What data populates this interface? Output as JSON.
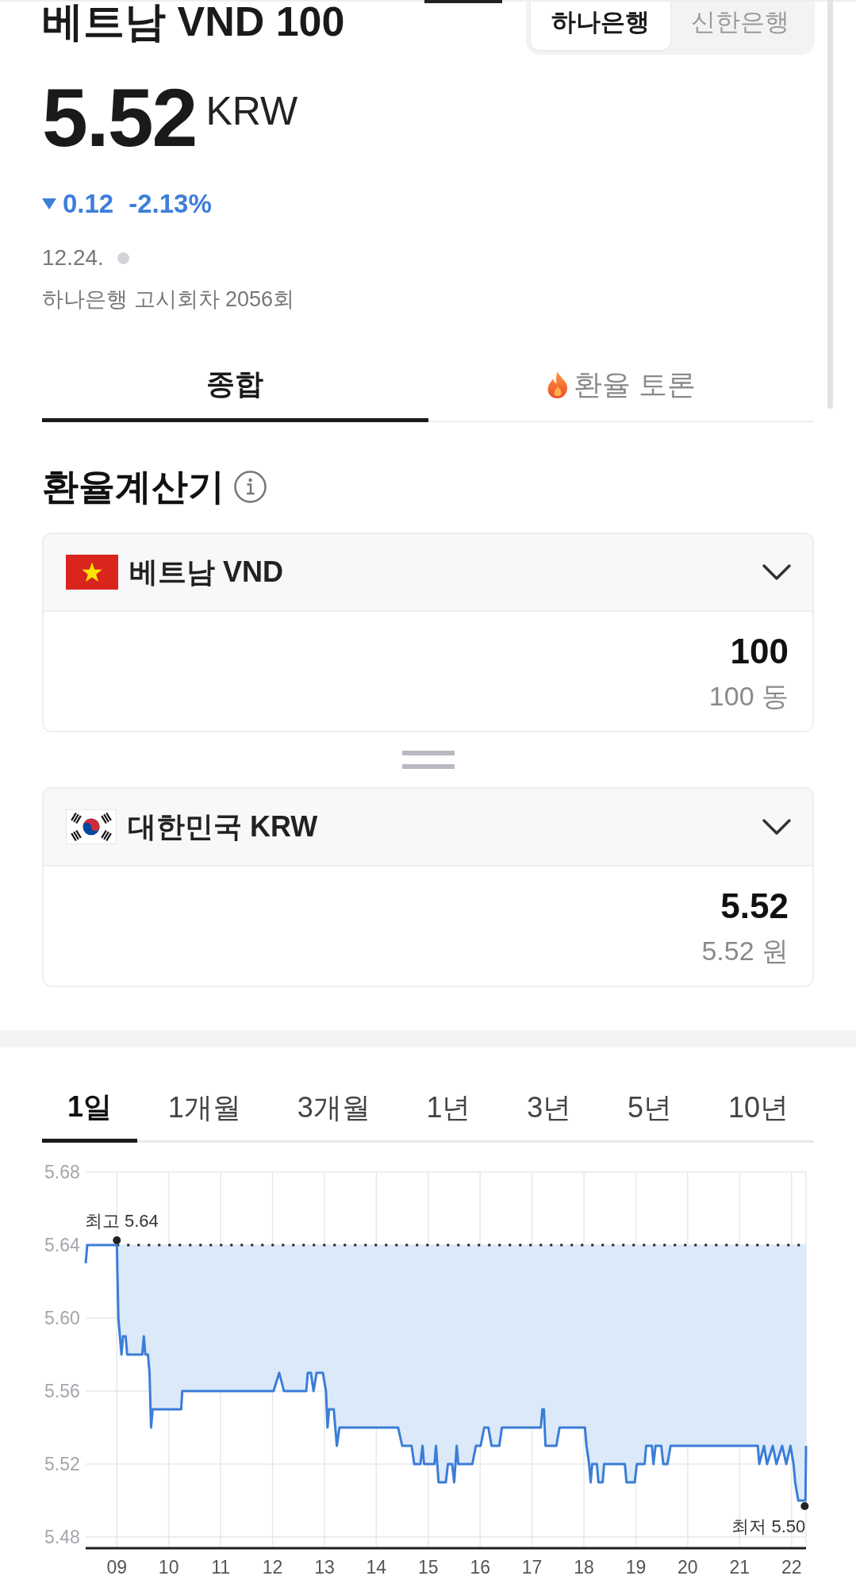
{
  "header": {
    "title": "베트남 VND 100",
    "banks": [
      {
        "label": "하나은행",
        "selected": true
      },
      {
        "label": "신한은행",
        "selected": false
      }
    ]
  },
  "quote": {
    "price": "5.52",
    "unit": "KRW",
    "falling": true,
    "change": "0.12",
    "change_percent": "-2.13%",
    "date": "12.24.",
    "notice": "하나은행 고시회차 2056회"
  },
  "tabs": [
    {
      "label": "종합",
      "selected": true,
      "hot": false
    },
    {
      "label": "환율 토론",
      "selected": false,
      "hot": true
    }
  ],
  "calculator": {
    "title": "환율계산기",
    "currencies": [
      {
        "kind": "vietnam",
        "name": "베트남 VND",
        "amount": "100",
        "amount_text": "100 동"
      },
      {
        "kind": "korea",
        "name": "대한민국 KRW",
        "amount": "5.52",
        "amount_text": "5.52 원"
      }
    ]
  },
  "chart": {
    "periods": [
      {
        "label": "1일",
        "selected": true
      },
      {
        "label": "1개월",
        "selected": false
      },
      {
        "label": "3개월",
        "selected": false
      },
      {
        "label": "1년",
        "selected": false
      },
      {
        "label": "3년",
        "selected": false
      },
      {
        "label": "5년",
        "selected": false
      },
      {
        "label": "10년",
        "selected": false
      }
    ],
    "chart_data": {
      "type": "line",
      "grid": true,
      "x": [
        8.4,
        8.43,
        9.0,
        9.03,
        9.09,
        9.12,
        9.17,
        9.2,
        9.49,
        9.52,
        9.55,
        9.6,
        9.63,
        9.66,
        9.69,
        10.24,
        10.26,
        12.02,
        12.13,
        12.22,
        12.65,
        12.68,
        12.74,
        12.79,
        12.85,
        12.97,
        13.03,
        13.06,
        13.09,
        13.18,
        13.24,
        13.29,
        14.42,
        14.5,
        14.68,
        14.73,
        14.85,
        14.89,
        14.92,
        15.12,
        15.15,
        15.2,
        15.34,
        15.38,
        15.46,
        15.5,
        15.55,
        15.58,
        15.85,
        15.92,
        16.01,
        16.08,
        16.16,
        16.22,
        16.37,
        16.42,
        17.17,
        17.2,
        17.23,
        17.26,
        17.47,
        17.53,
        18.02,
        18.05,
        18.1,
        18.13,
        18.16,
        18.25,
        18.28,
        18.36,
        18.39,
        18.79,
        18.82,
        18.98,
        19.02,
        19.17,
        19.2,
        19.31,
        19.34,
        19.38,
        19.49,
        19.53,
        19.61,
        19.67,
        21.35,
        21.38,
        21.47,
        21.53,
        21.64,
        21.71,
        21.82,
        21.9,
        21.98,
        22.04,
        22.07,
        22.13,
        22.27,
        22.28
      ],
      "series": [
        {
          "color": "#3b7dd8",
          "values": [
            5.63,
            5.64,
            5.64,
            5.6,
            5.58,
            5.59,
            5.59,
            5.58,
            5.58,
            5.59,
            5.58,
            5.58,
            5.57,
            5.54,
            5.55,
            5.55,
            5.56,
            5.56,
            5.57,
            5.56,
            5.56,
            5.57,
            5.57,
            5.56,
            5.57,
            5.57,
            5.56,
            5.54,
            5.55,
            5.55,
            5.53,
            5.54,
            5.54,
            5.53,
            5.53,
            5.52,
            5.52,
            5.53,
            5.52,
            5.52,
            5.53,
            5.51,
            5.51,
            5.52,
            5.52,
            5.51,
            5.53,
            5.52,
            5.52,
            5.53,
            5.53,
            5.54,
            5.54,
            5.53,
            5.53,
            5.54,
            5.54,
            5.55,
            5.55,
            5.53,
            5.53,
            5.54,
            5.54,
            5.53,
            5.52,
            5.51,
            5.52,
            5.52,
            5.51,
            5.51,
            5.52,
            5.52,
            5.51,
            5.51,
            5.52,
            5.52,
            5.53,
            5.53,
            5.52,
            5.53,
            5.53,
            5.52,
            5.52,
            5.53,
            5.53,
            5.52,
            5.53,
            5.52,
            5.53,
            5.52,
            5.53,
            5.52,
            5.53,
            5.52,
            5.51,
            5.5,
            5.5,
            5.53
          ]
        }
      ],
      "xlim": [
        8.4,
        22.28
      ],
      "ylim": [
        5.48,
        5.68
      ],
      "xticks": [
        {
          "value": 9,
          "label": "09"
        },
        10,
        11,
        12,
        13,
        14,
        15,
        16,
        17,
        18,
        19,
        20,
        21,
        22
      ],
      "yticks": [
        5.68,
        5.64,
        {
          "value": 5.6,
          "label": "5.60"
        },
        5.56,
        5.52,
        5.48
      ],
      "ref_lines": [
        {
          "axis": "y",
          "value": 5.64
        }
      ],
      "annotations": [
        {
          "text": "최고 5.64",
          "x": 9.0,
          "y": 5.64
        },
        {
          "text": "최저 5.50",
          "x": 22.27,
          "y": 5.5
        }
      ]
    }
  }
}
